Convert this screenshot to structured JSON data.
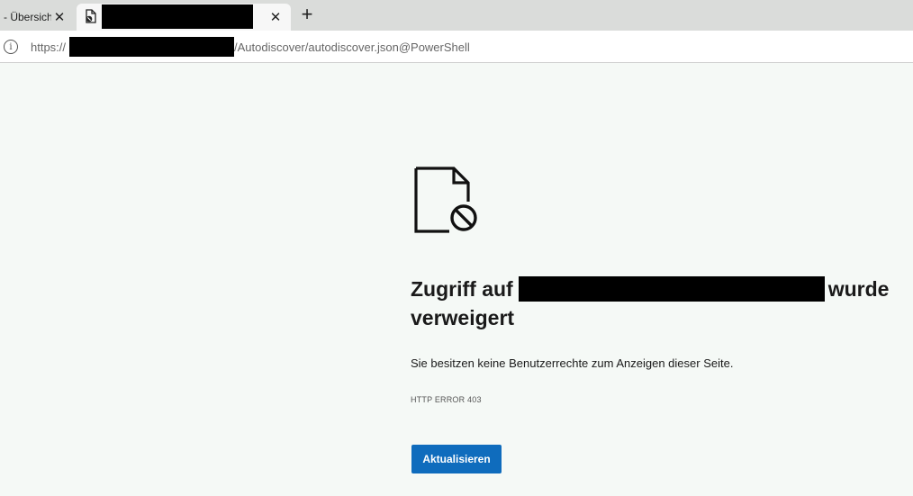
{
  "tabs": [
    {
      "title": "- Übersicht",
      "close_symbol": "✕",
      "icon": ""
    },
    {
      "title": "",
      "close_symbol": "✕",
      "icon": "blocked-page-icon"
    }
  ],
  "new_tab_symbol": "+",
  "address_bar": {
    "info_symbol": "i",
    "url_prefix": "https://",
    "url_suffix": "/Autodiscover/autodiscover.json@PowerShell"
  },
  "error_page": {
    "icon": "blocked-document-icon",
    "headline_start": "Zugriff auf",
    "headline_end": "wurde verweigert",
    "description": "Sie besitzen keine Benutzerrechte zum Anzeigen dieser Seite.",
    "error_code": "HTTP ERROR 403",
    "reload_label": "Aktualisieren"
  },
  "colors": {
    "accent": "#0f6cbd",
    "page_background": "#f5f9f6",
    "tabstrip_background": "#dadcda"
  }
}
